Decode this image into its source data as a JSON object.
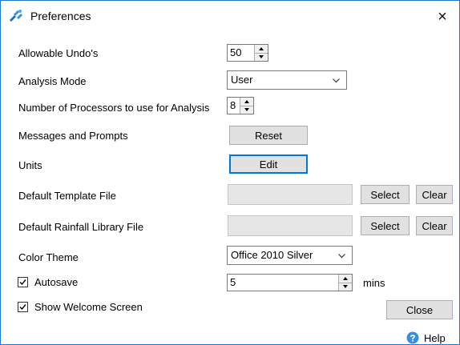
{
  "window": {
    "title": "Preferences",
    "close_label": "×"
  },
  "undo": {
    "label": "Allowable Undo's",
    "value": "50"
  },
  "analysis_mode": {
    "label": "Analysis Mode",
    "value": "User"
  },
  "processors": {
    "label": "Number of Processors to use for Analysis",
    "value": "8"
  },
  "messages": {
    "label": "Messages and Prompts",
    "button": "Reset"
  },
  "units": {
    "label": "Units",
    "button": "Edit"
  },
  "template_file": {
    "label": "Default Template File",
    "value": "",
    "select": "Select",
    "clear": "Clear"
  },
  "rainfall_file": {
    "label": "Default Rainfall Library File",
    "value": "",
    "select": "Select",
    "clear": "Clear"
  },
  "color_theme": {
    "label": "Color Theme",
    "value": "Office 2010 Silver"
  },
  "autosave": {
    "label": "Autosave",
    "checked": true,
    "value": "5",
    "unit": "mins"
  },
  "welcome": {
    "label": "Show Welcome Screen",
    "checked": true
  },
  "footer": {
    "close": "Close",
    "help": "Help"
  },
  "colors": {
    "accent": "#0078d7",
    "border": "#1f78c8",
    "button_bg": "#e1e1e1",
    "field_bg": "#e6e6e6"
  }
}
